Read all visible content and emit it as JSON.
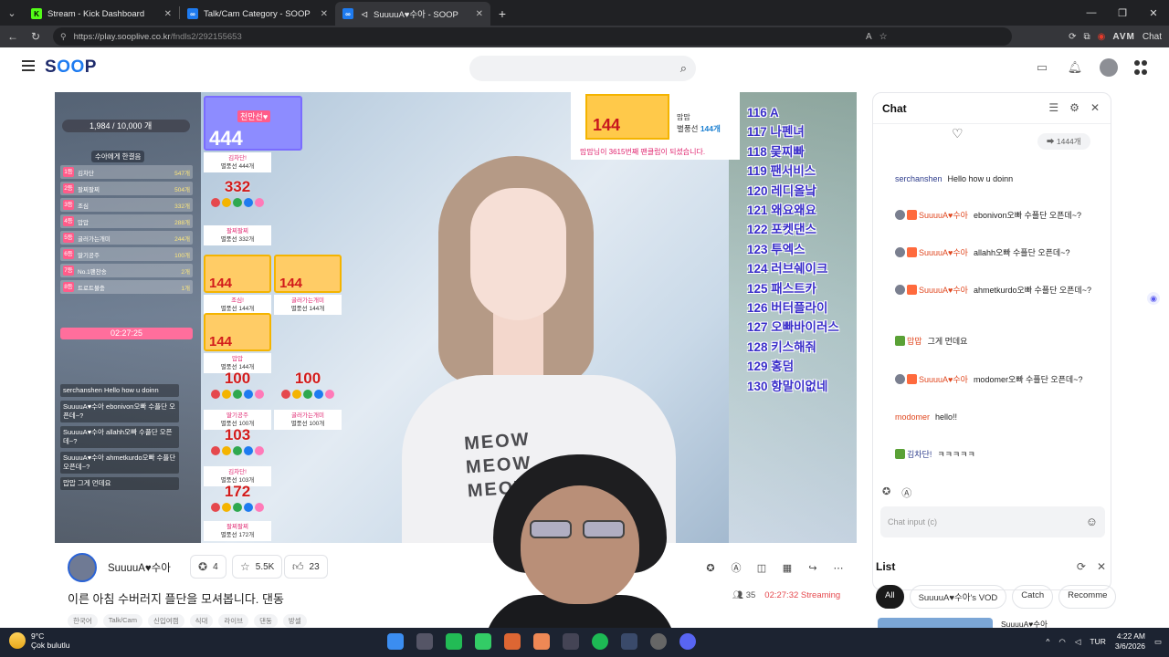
{
  "browser": {
    "tabs": [
      {
        "label": "Stream - Kick Dashboard",
        "icon": "kick-icon",
        "active": false
      },
      {
        "label": "Talk/Cam Category - SOOP",
        "icon": "soop-icon",
        "active": false
      },
      {
        "label": "SuuuuA♥수아 - SOOP",
        "icon": "soop-icon",
        "active": true
      }
    ],
    "url_host": "https://play.sooplive.co.kr",
    "url_path": "/fndls2/292155653",
    "ext_label": "AVM",
    "chat_label": "Chat"
  },
  "site": {
    "logo_prefix": "S",
    "logo_accent": "OO",
    "logo_suffix": "P",
    "search_placeholder": ""
  },
  "video": {
    "gift_total": "1,984 / 10,000 개",
    "rank_title": "수아에게 한결음",
    "rank_rows": [
      {
        "n": "1등",
        "name": "김차단",
        "v": "547개"
      },
      {
        "n": "2등",
        "name": "팔찌팔찌",
        "v": "504개"
      },
      {
        "n": "3등",
        "name": "조심",
        "v": "332개"
      },
      {
        "n": "4등",
        "name": "맙맙",
        "v": "288개"
      },
      {
        "n": "5등",
        "name": "굴러가는개미",
        "v": "244개"
      },
      {
        "n": "6등",
        "name": "딸기공주",
        "v": "100개"
      },
      {
        "n": "7등",
        "name": "No.1팬찬송",
        "v": "2개"
      },
      {
        "n": "8등",
        "name": "트로트불충",
        "v": "1개"
      }
    ],
    "timer": "02:27:25",
    "chat_lines": [
      "serchanshen Hello how u doinn",
      "SuuuuA♥수아 ebonivon오빠 수플단 오픈데~?",
      "SuuuuA♥수아 allahh오빠 수플단 오픈데~?",
      "SuuuuA♥수아 ahmetkurdo오빠 수플단 오픈데~?",
      "맙맙 그게 먼데요"
    ],
    "gifts": {
      "top": {
        "num": "444",
        "tag": "천만선♥",
        "name": "김차단!",
        "sub": "별풍선 444개"
      },
      "g332": {
        "num": "332",
        "name": "팔찌팔찌",
        "sub": "별풍선 332개"
      },
      "g144a": {
        "num": "144",
        "name": "조심!",
        "sub": "별풍선 144개"
      },
      "g144b": {
        "num": "144",
        "name": "굴러가는개미",
        "sub": "별풍선 144개"
      },
      "g144c": {
        "num": "144",
        "name": "맙맙",
        "sub": "별풍선 144개"
      },
      "g100a": {
        "num": "100",
        "name": "딸기공주",
        "sub": "별풍선 100개"
      },
      "g100b": {
        "num": "100",
        "name": "굴러가는개미",
        "sub": "별풍선 100개"
      },
      "g103": {
        "num": "103",
        "name": "김차단!",
        "sub": "별풍선 103개"
      },
      "g172": {
        "num": "172",
        "name": "팔찌팔찌",
        "sub": "별풍선 172개"
      }
    },
    "top_gift": {
      "num": "144",
      "t1": "맙맙",
      "t2_prefix": "별풍선 ",
      "t2_value": "144개",
      "t3": "맙맙님이 3615번째 팬클럽이 되셨습니다."
    },
    "right_list": [
      "116 A",
      "117 나펜녀",
      "118 뭊찌빠",
      "119 팬서비스",
      "120 레디올낰",
      "121 왜요왜요",
      "122 포켓댄스",
      "123 투엑스",
      "124 러브쉐이크",
      "125 패스트카",
      "126 버터플라이",
      "127 오빠바이러스",
      "128 키스해줘",
      "129 홍덤",
      "130 항말이없네"
    ],
    "shirt_text": "MEOW\nMEOW\nMEOW"
  },
  "stream": {
    "streamer": "SuuuuA♥수아",
    "recommend_count": "4",
    "favorite_count": "5.5K",
    "like_count": "23",
    "title": "이른 아침 수버러지 플단을 모셔봅니다. 댄동",
    "tags": [
      "한국어",
      "Talk/Cam",
      "신입여캠",
      "식대",
      "라이브",
      "댄동",
      "방셀"
    ],
    "viewers": "35",
    "uptime": "02:27:32 Streaming"
  },
  "chat": {
    "title": "Chat",
    "gift_count": "1444개",
    "messages": [
      {
        "user": "serchanshen",
        "text": "Hello how u doinn",
        "style": "blue",
        "badge": ""
      },
      {
        "user": "SuuuuA♥수아",
        "text": "ebonivon오빠 수플단 오픈데~?",
        "style": "red",
        "badge": "host"
      },
      {
        "user": "SuuuuA♥수아",
        "text": "allahh오빠 수플단 오픈데~?",
        "style": "red",
        "badge": "host"
      },
      {
        "user": "SuuuuA♥수아",
        "text": "ahmetkurdo오빠 수플단 오픈데~?",
        "style": "red",
        "badge": "host"
      },
      {
        "user": "맙맙",
        "text": "그게 먼데요",
        "style": "red",
        "badge": "fan"
      },
      {
        "user": "SuuuuA♥수아",
        "text": "modomer오빠 수플단 오픈데~?",
        "style": "red",
        "badge": "host"
      },
      {
        "user": "modomer",
        "text": "hello!!",
        "style": "red",
        "badge": ""
      },
      {
        "user": "김차단!",
        "text": "ㅋㅋㅋㅋㅋ",
        "style": "blue",
        "badge": "fan"
      }
    ],
    "input_placeholder": "Chat input (c)"
  },
  "list": {
    "title": "List",
    "chips": [
      "All",
      "SuuuuA♥수아's VOD",
      "Catch",
      "Recomme"
    ],
    "first_item": "SuuuuA♥수아"
  },
  "taskbar": {
    "temp": "9°C",
    "weather": "Çok bulutlu",
    "lang": "TUR",
    "time": "4:22 AM",
    "date": "3/6/2026"
  },
  "colors": {
    "accent": "#1e7bf0",
    "live": "#e5484d",
    "host_name": "#e0471f",
    "user_name": "#2e3d8c"
  }
}
